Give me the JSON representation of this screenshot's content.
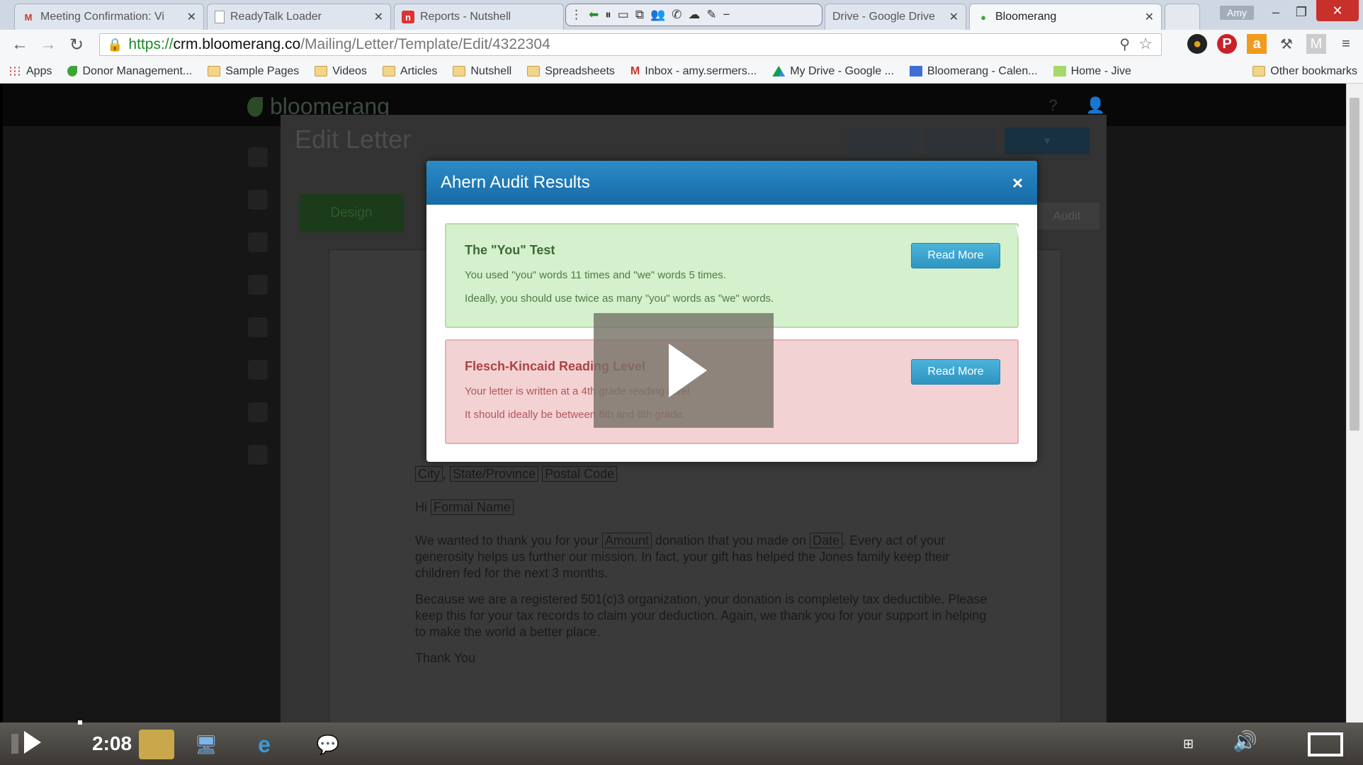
{
  "browser": {
    "tabs": [
      {
        "label": "Meeting Confirmation: Vi",
        "icon": "gmail-icon"
      },
      {
        "label": "ReadyTalk Loader",
        "icon": "page-icon"
      },
      {
        "label": "Reports - Nutshell",
        "icon": "nutshell-icon"
      },
      {
        "label": "Drive - Google Drive",
        "icon": "drive-icon"
      },
      {
        "label": "Bloomerang",
        "icon": "bloomerang-icon"
      }
    ],
    "user_badge": "Amy",
    "url": {
      "scheme": "https://",
      "host": "crm.bloomerang.co",
      "path": "/Mailing/Letter/Template/Edit/4322304"
    },
    "bookmarks": [
      {
        "label": "Apps",
        "icon": "apps-grid-icon"
      },
      {
        "label": "Donor Management...",
        "icon": "bloomerang-leaf-icon"
      },
      {
        "label": "Sample Pages",
        "icon": "folder-icon"
      },
      {
        "label": "Videos",
        "icon": "folder-icon"
      },
      {
        "label": "Articles",
        "icon": "folder-icon"
      },
      {
        "label": "Nutshell",
        "icon": "folder-icon"
      },
      {
        "label": "Spreadsheets",
        "icon": "folder-icon"
      },
      {
        "label": "Inbox - amy.sermers...",
        "icon": "gmail-icon"
      },
      {
        "label": "My Drive - Google ...",
        "icon": "drive-icon"
      },
      {
        "label": "Bloomerang - Calen...",
        "icon": "calendar-icon"
      },
      {
        "label": "Home - Jive",
        "icon": "jive-icon"
      }
    ],
    "other_bookmarks": "Other bookmarks"
  },
  "app": {
    "logo_text": "bloomerang",
    "page_title": "Edit Letter",
    "design_button": "Design",
    "audit_tab": "Audit"
  },
  "letter": {
    "address_city": "City",
    "address_state": "State/Province",
    "address_postal": "Postal Code",
    "greeting_prefix": "Hi",
    "greeting_field": "Formal Name",
    "p1_before_amount": "We wanted to thank you for your",
    "p1_amount_field": "Amount",
    "p1_middle": "donation that you made on",
    "p1_date_field": "Date",
    "p1_after": ". Every act of your generosity helps us further our mission. In fact, your gift has helped the Jones family keep their children fed for the next 3 months.",
    "p2": "Because we are a registered 501(c)3 organization, your donation is completely tax deductible. Please keep this for your tax records to claim your deduction. Again, we thank you for your support in helping to make the world a better place.",
    "closing": "Thank You"
  },
  "modal": {
    "title": "Ahern Audit Results",
    "close": "×",
    "results": [
      {
        "title": "The \"You\" Test",
        "line1": "You used \"you\" words 11 times and \"we\" words 5 times.",
        "line2": "Ideally, you should use twice as many \"you\" words as \"we\" words.",
        "button": "Read More",
        "status_color": "#d4f0cd"
      },
      {
        "title": "Flesch-Kincaid Reading Level",
        "line1": "Your letter is written at a 4th grade reading level.",
        "line2": "It should ideally be between 6th and 8th grade.",
        "button": "Read More",
        "status_color": "#f3d2d4"
      }
    ]
  },
  "video": {
    "time": "2:08"
  }
}
